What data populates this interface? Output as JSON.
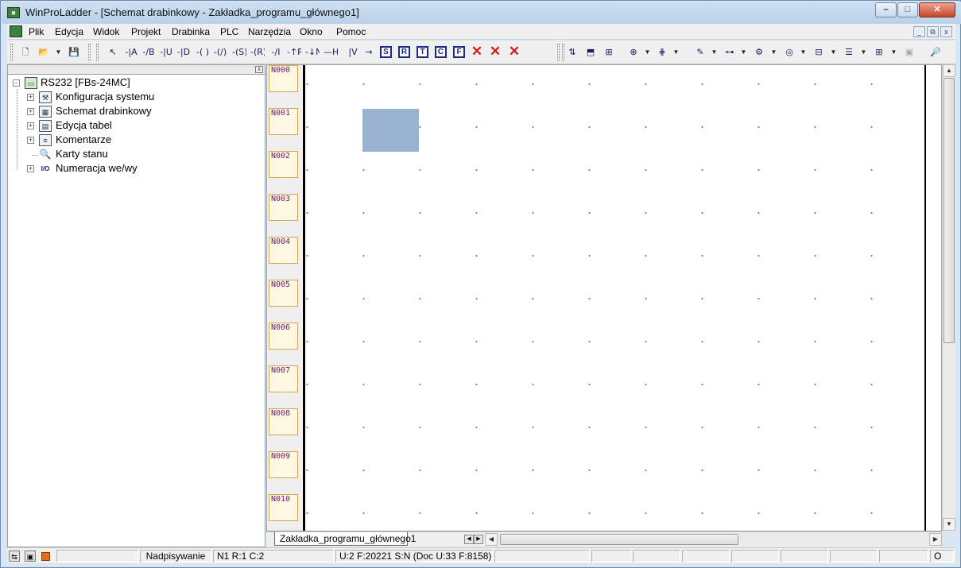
{
  "window": {
    "title": "WinProLadder - [Schemat drabinkowy - Zakładka_programu_głównego1]",
    "controls": {
      "minimize": "–",
      "maximize": "□",
      "close": "✕"
    }
  },
  "menu": {
    "items": [
      "Plik",
      "Edycja",
      "Widok",
      "Projekt",
      "Drabinka",
      "PLC",
      "Narzędzia",
      "Okno",
      "Pomoc"
    ],
    "mdi_controls": {
      "minimize": "_",
      "restore": "⧉",
      "close": "x"
    }
  },
  "toolbar": {
    "letters": [
      "S",
      "R",
      "T",
      "C",
      "F"
    ],
    "contact_glyphs": [
      "↖",
      "-|A",
      "-/B",
      "-|U",
      "-|D",
      "-( )",
      "-(/)",
      "-(S)",
      "-(R)",
      "-/I",
      "-↑P",
      "-↓N",
      "—H",
      "|V",
      "→"
    ],
    "delete_glyphs": [
      "✕",
      "✕",
      "✕"
    ]
  },
  "tree": {
    "root": "RS232 [FBs-24MC]",
    "items": [
      {
        "label": "Konfiguracja systemu",
        "icon": "tools-icon",
        "glyph": "⚒",
        "expandable": true
      },
      {
        "label": "Schemat drabinkowy",
        "icon": "ladder-diagram-icon",
        "glyph": "▦",
        "expandable": true
      },
      {
        "label": "Edycja tabel",
        "icon": "table-icon",
        "glyph": "▤",
        "expandable": true
      },
      {
        "label": "Komentarze",
        "icon": "comments-icon",
        "glyph": "≡",
        "expandable": true
      },
      {
        "label": "Karty stanu",
        "icon": "status-cards-icon",
        "glyph": "🔍",
        "expandable": false
      },
      {
        "label": "Numeracja we/wy",
        "icon": "io-numbering-icon",
        "glyph": "I/O",
        "expandable": true
      }
    ],
    "close_glyph": "x",
    "expand_glyph": "+",
    "collapse_glyph": "-"
  },
  "ladder": {
    "rungs": [
      "N000",
      "N001",
      "N002",
      "N003",
      "N004",
      "N005",
      "N006",
      "N007",
      "N008",
      "N009",
      "N010"
    ]
  },
  "tabs": {
    "active": "Zakładka_programu_głównego1"
  },
  "status": {
    "mode": "Nadpisywanie",
    "position": "N1 R:1 C:2",
    "memory": "U:2 F:20221 S:N (Doc U:33 F:8158)",
    "last": "O"
  }
}
